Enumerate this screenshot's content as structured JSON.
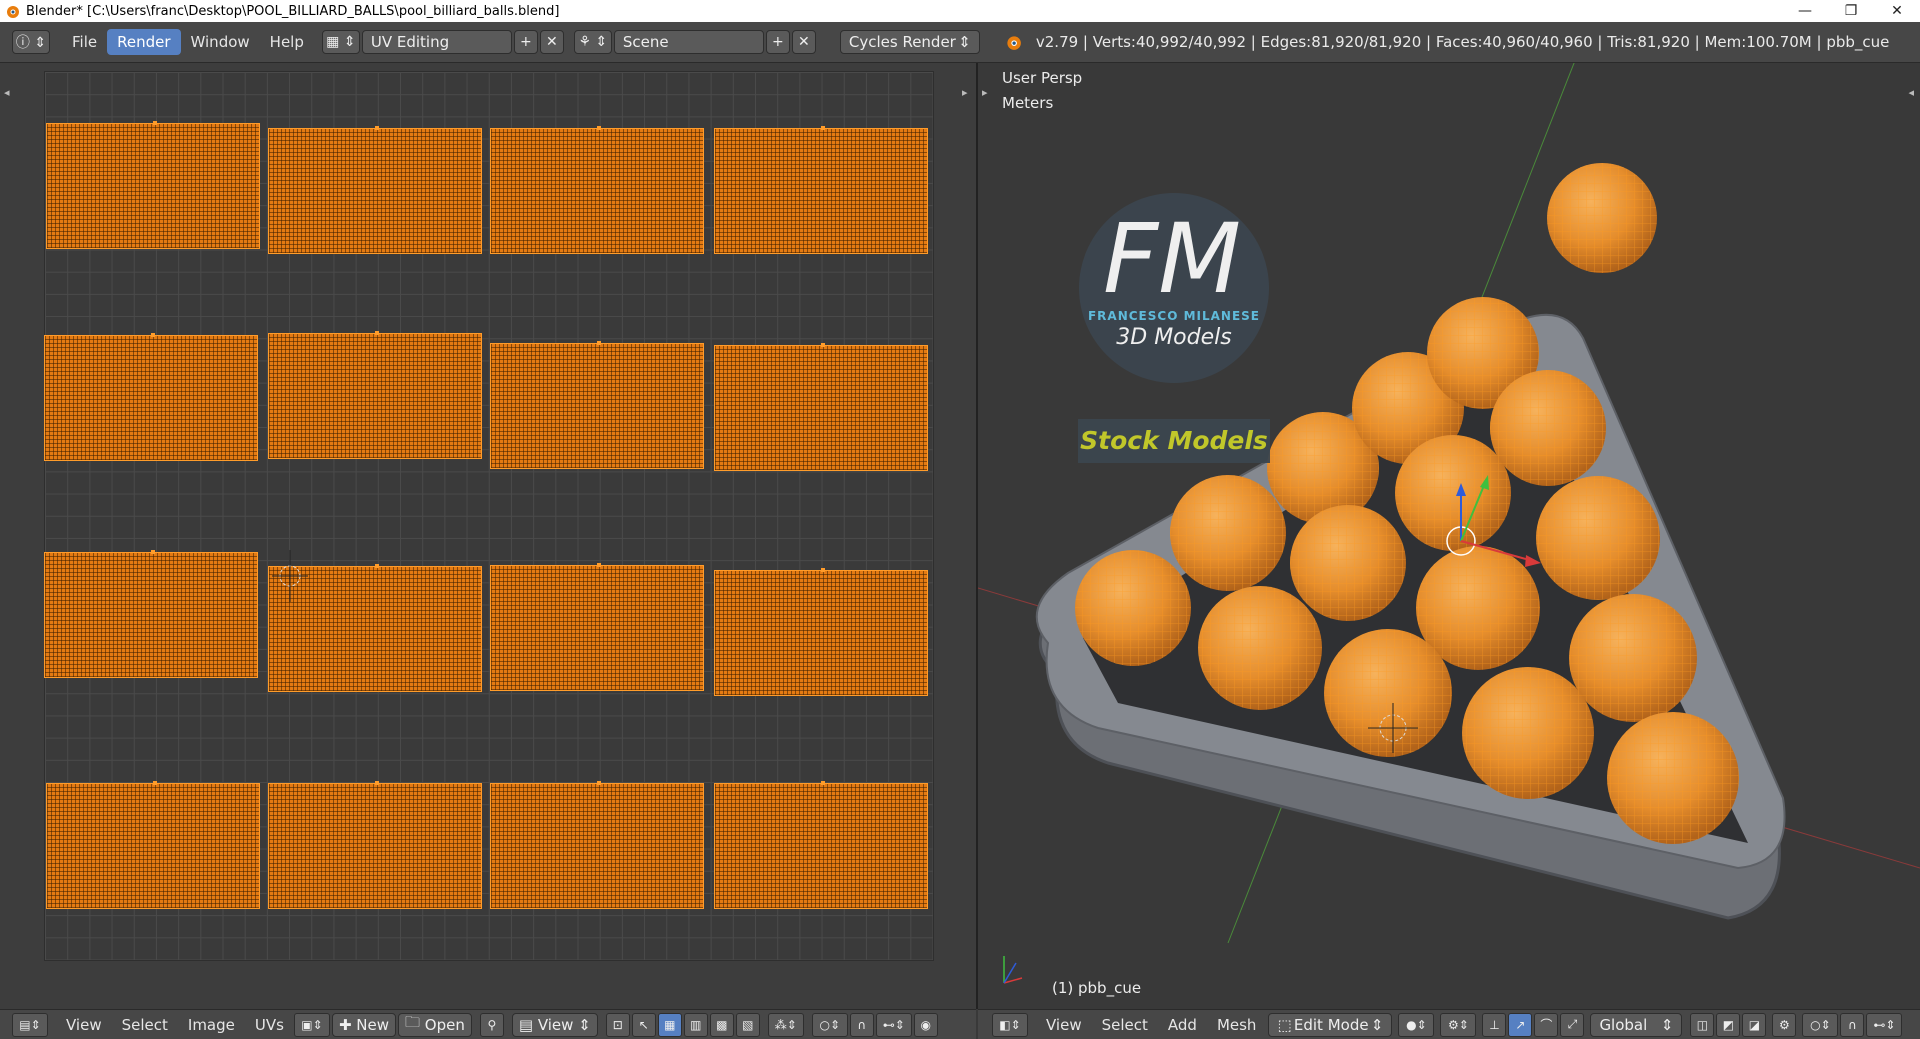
{
  "window": {
    "title": "Blender* [C:\\Users\\franc\\Desktop\\POOL_BILLIARD_BALLS\\pool_billiard_balls.blend]",
    "controls": [
      "—",
      "❐",
      "✕"
    ]
  },
  "infobar": {
    "menus": [
      "File",
      "Render",
      "Window",
      "Help"
    ],
    "active_menu": "Render",
    "layout": "UV Editing",
    "scene": "Scene",
    "engine": "Cycles Render",
    "stats": "v2.79 | Verts:40,992/40,992 | Edges:81,920/81,920 | Faces:40,960/40,960 | Tris:81,920 | Mem:100.70M | pbb_cue"
  },
  "viewport": {
    "view_name": "User Persp",
    "units": "Meters",
    "object_label": "(1) pbb_cue",
    "logo_initials": "FM",
    "logo_brand": "FRANCESCO MILANESE",
    "logo_sub": "3D Models",
    "logo_banner": "Stock Models"
  },
  "uv_header": {
    "items": [
      "View",
      "Select",
      "Image",
      "UVs"
    ],
    "new_label": "New",
    "open_label": "Open",
    "view_label": "View"
  },
  "vp_header": {
    "items": [
      "View",
      "Select",
      "Add",
      "Mesh"
    ],
    "mode": "Edit Mode",
    "orientation": "Global"
  },
  "colors": {
    "accent": "#5680c2",
    "uv_island": "#e47a12",
    "background": "#393939"
  }
}
